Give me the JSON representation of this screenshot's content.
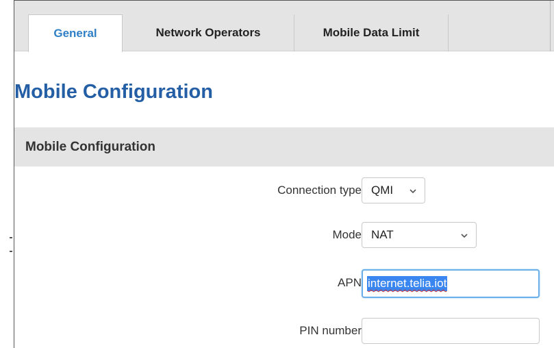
{
  "tabs": [
    {
      "label": "General",
      "active": true
    },
    {
      "label": "Network Operators",
      "active": false
    },
    {
      "label": "Mobile Data Limit",
      "active": false
    }
  ],
  "page_title": "Mobile Configuration",
  "section": {
    "title": "Mobile Configuration"
  },
  "fields": {
    "connection_type": {
      "label": "Connection type",
      "value": "QMI"
    },
    "mode": {
      "label": "Mode",
      "value": "NAT"
    },
    "apn": {
      "label": "APN",
      "value": "internet.telia.iot"
    },
    "pin": {
      "label": "PIN number",
      "value": ""
    }
  },
  "colors": {
    "accent": "#2f7fc6",
    "title": "#245fa6",
    "tab_bar": "#e4e4e4",
    "focus_border": "#6aaeea",
    "selection": "#3a86f0"
  }
}
